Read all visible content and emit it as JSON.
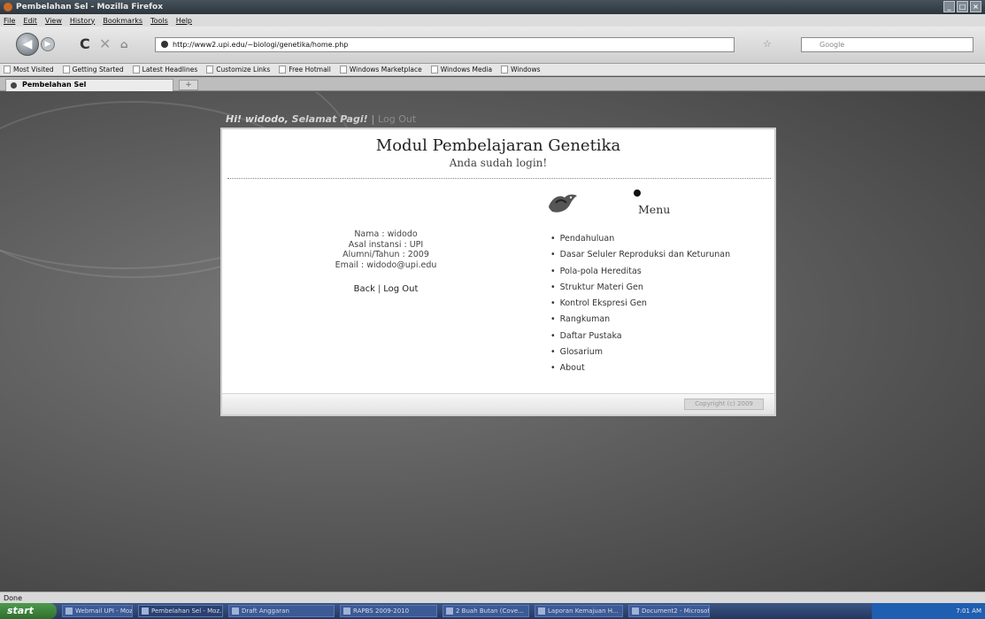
{
  "window": {
    "title": "Pembelahan Sel - Mozilla Firefox",
    "buttons": [
      "_",
      "□",
      "×"
    ]
  },
  "menubar": [
    "File",
    "Edit",
    "View",
    "History",
    "Bookmarks",
    "Tools",
    "Help"
  ],
  "navbar": {
    "url": "http://www2.upi.edu/~biologi/genetika/home.php",
    "search_placeholder": "Google"
  },
  "bookmarks": [
    "Most Visited",
    "Getting Started",
    "Latest Headlines",
    "Customize Links",
    "Free Hotmail",
    "Windows Marketplace",
    "Windows Media",
    "Windows"
  ],
  "tab": {
    "title": "Pembelahan Sel",
    "new_tab": "+"
  },
  "greeting": {
    "hi": "Hi! widodo,",
    "salam": "Selamat Pagi!",
    "sep": "|",
    "logout": "Log Out"
  },
  "panel": {
    "title": "Modul Pembelajaran Genetika",
    "subtitle": "Anda sudah login!",
    "user": {
      "nama": "Nama : widodo",
      "instansi": "Asal instansi : UPI",
      "alumni": "Alumni/Tahun : 2009",
      "email": "Email : widodo@upi.edu"
    },
    "links": {
      "back": "Back",
      "sep": "|",
      "logout": "Log Out"
    },
    "menu_title": "Menu",
    "menu": [
      "Pendahuluan",
      "Dasar Seluler Reproduksi dan Keturunan",
      "Pola-pola Hereditas",
      "Struktur Materi Gen",
      "Kontrol Ekspresi Gen",
      "Rangkuman",
      "Daftar Pustaka",
      "Glosarium",
      "About"
    ],
    "footer_button": "Copyright (c) 2009"
  },
  "status": "Done",
  "taskbar": {
    "start": "start",
    "tasks": [
      "Webmail UPI - Mozilla",
      "Pembelahan Sel - Moz...",
      "Draft Anggaran",
      "RAPBS 2009-2010",
      "2 Buah Butan (Cove...",
      "Laporan Kemajuan H...",
      "Document2 - Microsof"
    ],
    "clock": "7:01 AM"
  }
}
